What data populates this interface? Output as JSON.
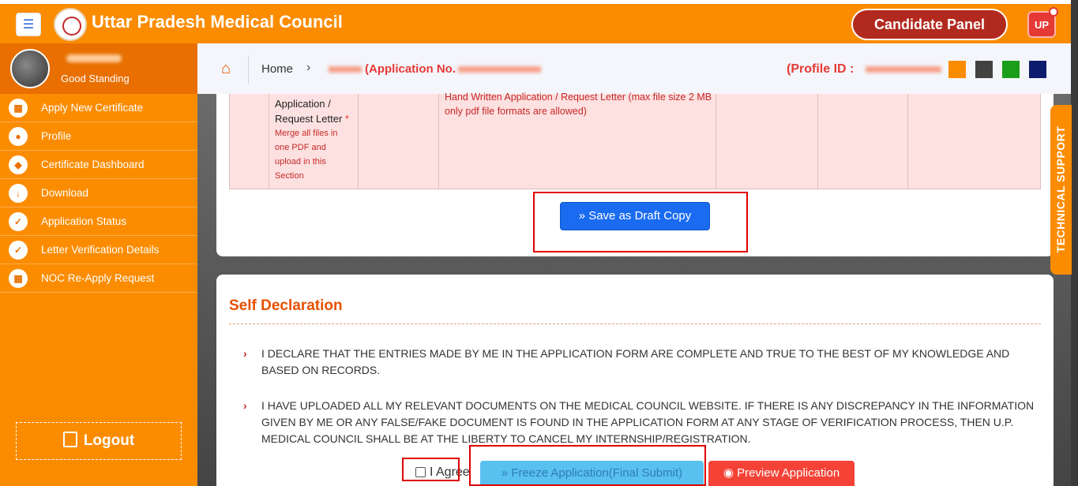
{
  "header": {
    "menu_icon": "hamburger-icon",
    "title": "Uttar Pradesh Medical Council",
    "panel_label": "Candidate Panel",
    "badge": "UP"
  },
  "sidebar": {
    "status": "Good Standing",
    "items": [
      {
        "label": "Apply New Certificate",
        "icon": "grid-icon"
      },
      {
        "label": "Profile",
        "icon": "user-icon"
      },
      {
        "label": "Certificate Dashboard",
        "icon": "shield-icon"
      },
      {
        "label": "Download",
        "icon": "download-icon"
      },
      {
        "label": "Application Status",
        "icon": "check-circle-icon"
      },
      {
        "label": "Letter Verification Details",
        "icon": "check-circle-icon"
      },
      {
        "label": "NOC Re-Apply Request",
        "icon": "grid-icon"
      }
    ],
    "logout_label": "Logout"
  },
  "breadcrumb": {
    "home": "Home",
    "application_no_label": "(Application No.",
    "profile_id_label": "(Profile ID :"
  },
  "theme_swatches": [
    "#fb8c00",
    "#424242",
    "#1a9e1a",
    "#0d1b6e"
  ],
  "document_row": {
    "title": "Application / Request Letter",
    "required_mark": "*",
    "note": "Merge all files in one PDF and upload in this Section",
    "description": "Hand Written Application / Request Letter (max file size 2 MB only pdf file formats are allowed)"
  },
  "actions": {
    "save_draft_label": "» Save as Draft Copy",
    "freeze_label": "» Freeze Application(Final Submit)",
    "preview_label": "Preview Application"
  },
  "support_tab": "TECHNICAL SUPPORT",
  "declaration": {
    "title": "Self Declaration",
    "items": [
      "I DECLARE THAT THE ENTRIES MADE BY ME IN THE APPLICATION FORM ARE COMPLETE AND TRUE TO THE BEST OF MY KNOWLEDGE AND BASED ON RECORDS.",
      "I HAVE UPLOADED ALL MY RELEVANT DOCUMENTS ON THE MEDICAL COUNCIL WEBSITE. IF THERE IS ANY DISCREPANCY IN THE INFORMATION GIVEN BY ME OR ANY FALSE/FAKE DOCUMENT IS FOUND IN THE APPLICATION FORM AT ANY STAGE OF VERIFICATION PROCESS, THEN U.P. MEDICAL COUNCIL SHALL BE AT THE LIBERTY TO CANCEL MY INTERNSHIP/REGISTRATION."
    ],
    "agree_label": "I Agree"
  }
}
